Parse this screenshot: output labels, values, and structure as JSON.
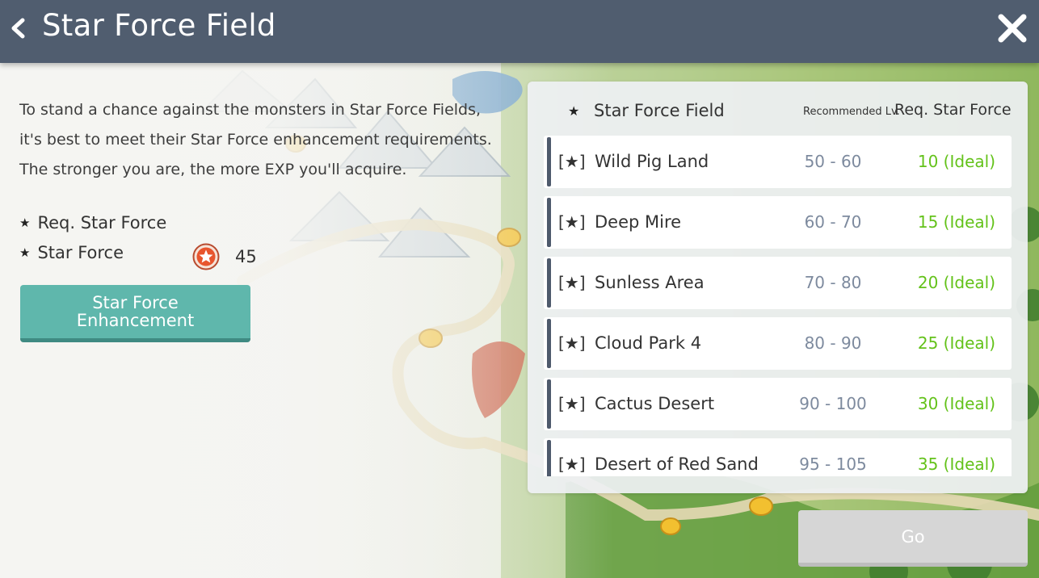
{
  "header": {
    "title": "Star Force Field"
  },
  "description": {
    "lines": [
      "To stand a chance against the monsters in Star Force Fields,",
      "it's best to meet their Star Force enhancement requirements.",
      "The stronger you are, the more EXP you'll acquire."
    ]
  },
  "stats": {
    "req_label": "Req. Star Force",
    "sf_label": "Star Force",
    "sf_value": "45",
    "bullet": "★"
  },
  "enhance_button": {
    "line1": "Star Force",
    "line2": "Enhancement"
  },
  "list_header": {
    "star": "★",
    "name": "Star Force Field",
    "level": "Recommended Lv.",
    "req": "Req. Star Force"
  },
  "fields": [
    {
      "tag": "[★]",
      "name": "Wild Pig Land",
      "level": "50 - 60",
      "req": "10 (Ideal)"
    },
    {
      "tag": "[★]",
      "name": "Deep Mire",
      "level": "60 - 70",
      "req": "15 (Ideal)"
    },
    {
      "tag": "[★]",
      "name": "Sunless Area",
      "level": "70 - 80",
      "req": "20 (Ideal)"
    },
    {
      "tag": "[★]",
      "name": "Cloud Park 4",
      "level": "80 - 90",
      "req": "25 (Ideal)"
    },
    {
      "tag": "[★]",
      "name": "Cactus Desert",
      "level": "90 - 100",
      "req": "30 (Ideal)"
    },
    {
      "tag": "[★]",
      "name": "Desert of Red Sand",
      "level": "95 - 105",
      "req": "35 (Ideal)"
    }
  ],
  "go_button": {
    "label": "Go"
  },
  "colors": {
    "header_bg": "#505d6f",
    "accent_teal": "#5fb7ac",
    "ideal_green": "#63c21a",
    "level_gray": "#7d8a9e",
    "disabled_button": "#d6d6d6"
  },
  "icons": {
    "back": "chevron-left-icon",
    "close": "close-icon",
    "star_force_badge": "star-force-badge-icon"
  }
}
